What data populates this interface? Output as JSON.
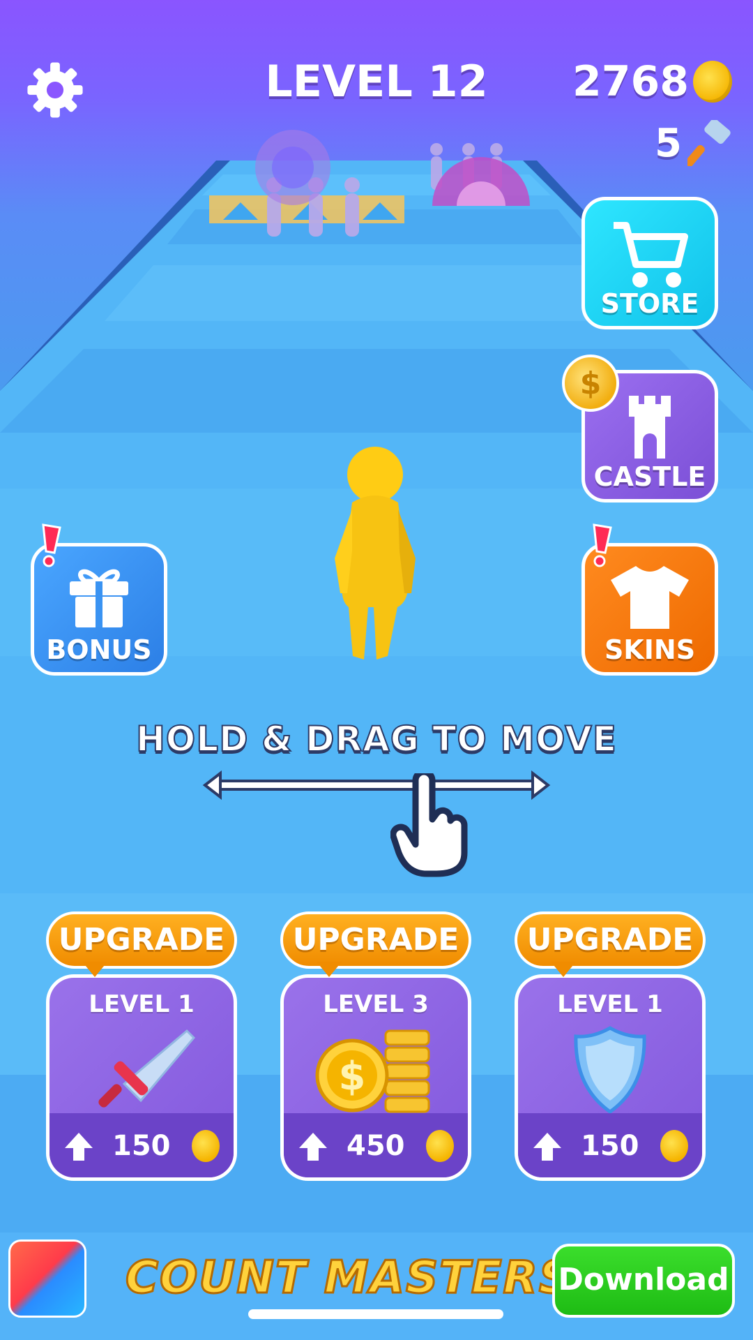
{
  "hud": {
    "level_label": "LEVEL 12",
    "coins": "2768",
    "hammers": "5"
  },
  "side_buttons": {
    "store": "STORE",
    "castle": "CASTLE",
    "skins": "SKINS",
    "bonus": "BONUS"
  },
  "hint": "HOLD & DRAG TO MOVE",
  "upgrades": [
    {
      "tag": "UPGRADE",
      "level": "LEVEL 1",
      "cost": "150",
      "icon": "sword-icon"
    },
    {
      "tag": "UPGRADE",
      "level": "LEVEL 3",
      "cost": "450",
      "icon": "coins-icon"
    },
    {
      "tag": "UPGRADE",
      "level": "LEVEL 1",
      "cost": "150",
      "icon": "shield-icon"
    }
  ],
  "ad": {
    "title": "COUNT MASTERS",
    "download_label": "Download"
  },
  "colors": {
    "sky_top": "#8a55ff",
    "track": "#4fb4f6",
    "store": "#2ee6ff",
    "castle": "#8a5fe6",
    "skins": "#f57a0f",
    "bonus": "#3a93f2",
    "upgrade_tag": "#f59a0a",
    "upgrade_card": "#8d63e2",
    "download": "#27c91c",
    "coin": "#f5b400"
  }
}
